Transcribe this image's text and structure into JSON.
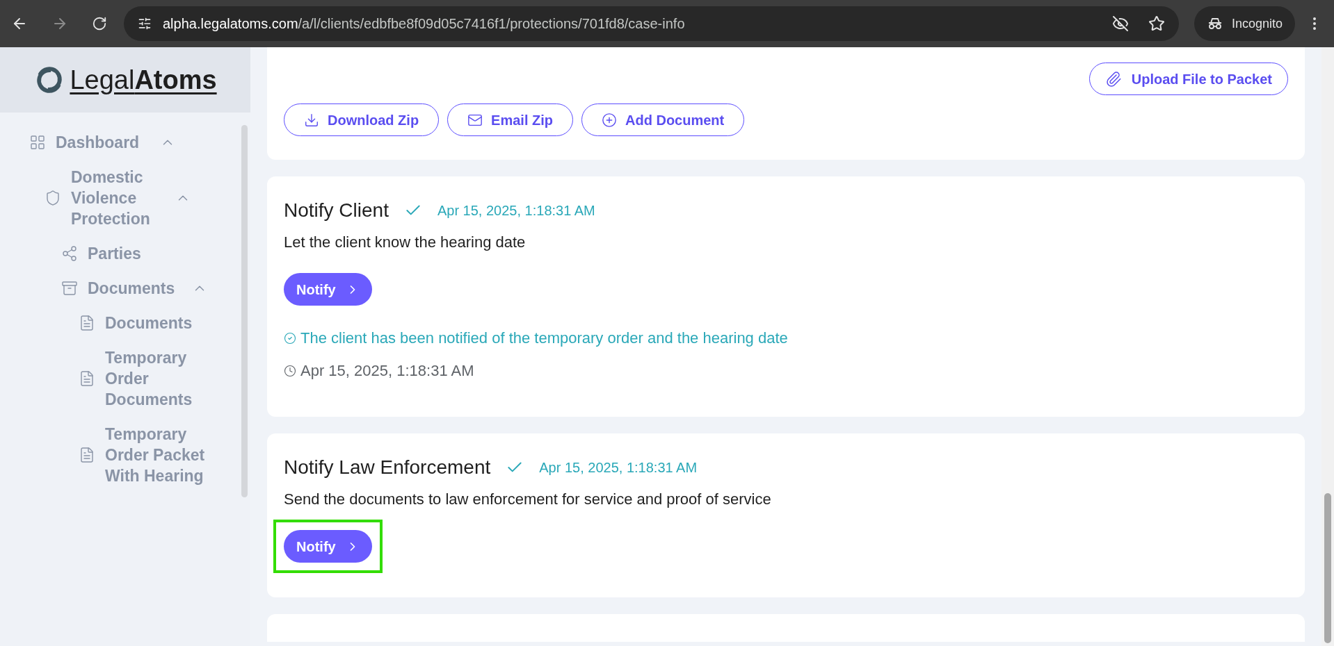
{
  "browser": {
    "url_host": "alpha.legalatoms.com",
    "url_path": "/a/l/clients/edbfbe8f09d05c7416f1/protections/701fd8/case-info",
    "profile": "Incognito"
  },
  "sidebar": {
    "logo": {
      "light": "Legal",
      "bold": "Atoms"
    },
    "items": [
      {
        "label": "Dashboard",
        "kind": "dashboard",
        "expanded": true,
        "children": [
          {
            "label": "Domestic Violence Protection",
            "kind": "shield",
            "expanded": true,
            "children": [
              {
                "label": "Parties",
                "kind": "share"
              },
              {
                "label": "Documents",
                "kind": "archive",
                "expanded": true,
                "children": [
                  {
                    "label": "Documents",
                    "kind": "file"
                  },
                  {
                    "label": "Temporary Order Documents",
                    "kind": "file"
                  },
                  {
                    "label": "Temporary Order Packet With Hearing",
                    "kind": "file"
                  }
                ]
              }
            ]
          }
        ]
      }
    ]
  },
  "packet_card": {
    "upload_button": "Upload File to Packet",
    "buttons": [
      {
        "label": "Download Zip",
        "kind": "download"
      },
      {
        "label": "Email Zip",
        "kind": "email"
      },
      {
        "label": "Add Document",
        "kind": "add"
      }
    ]
  },
  "steps": [
    {
      "title": "Notify Client",
      "done": true,
      "date": "Apr 15, 2025, 1:18:31 AM",
      "description": "Let the client know the hearing date",
      "action": "Notify",
      "highlighted": false,
      "notes": [
        {
          "kind": "done",
          "text": "The client has been notified of the temporary order and the hearing date"
        },
        {
          "kind": "time",
          "text": "Apr 15, 2025, 1:18:31 AM"
        }
      ]
    },
    {
      "title": "Notify Law Enforcement",
      "done": true,
      "date": "Apr 15, 2025, 1:18:31 AM",
      "description": "Send the documents to law enforcement for service and proof of service",
      "action": "Notify",
      "highlighted": true
    }
  ]
}
